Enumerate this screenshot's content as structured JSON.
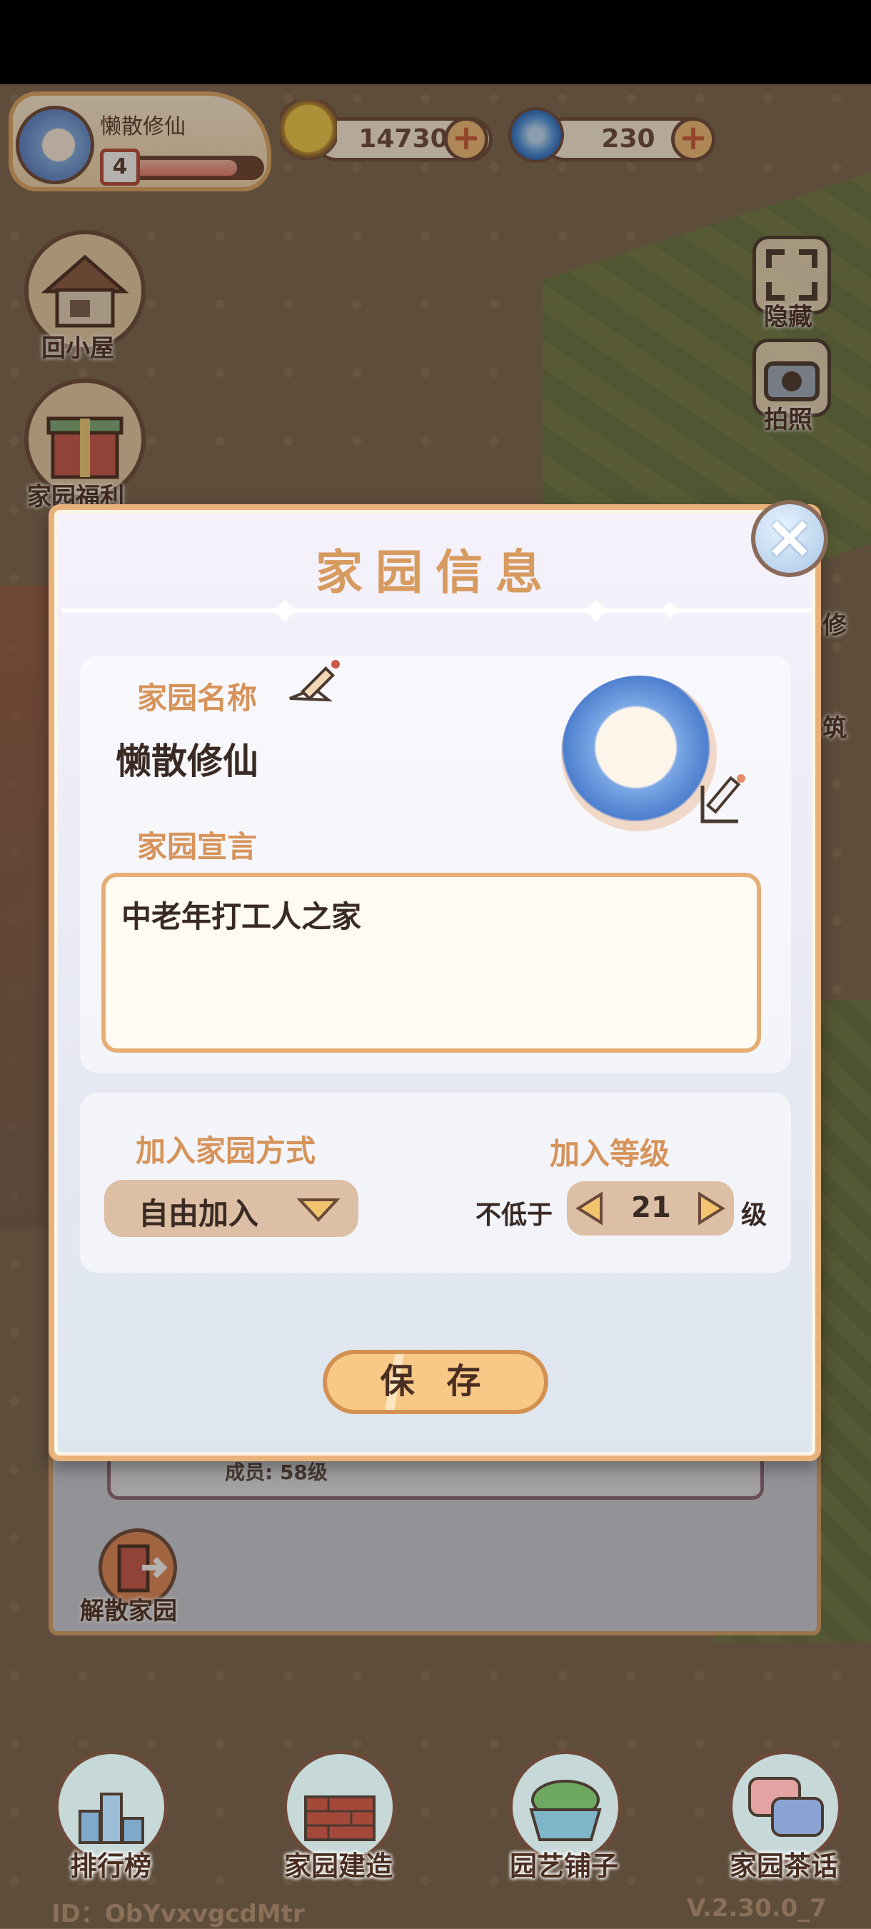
{
  "hud": {
    "player_name": "懒散修仙",
    "player_level": "4",
    "coins": "14730",
    "gems": "230",
    "level_progress": 0.8
  },
  "left_menu": {
    "home": "回小屋",
    "benefits": "家园福利"
  },
  "right_menu": {
    "hide": "隐藏",
    "photo": "拍照",
    "decorate": "修",
    "build": "筑"
  },
  "dialog": {
    "title": "家园信息",
    "name_label": "家园名称",
    "name_value": "懒散修仙",
    "declaration_label": "家园宣言",
    "declaration_value": "中老年打工人之家",
    "join_method_label": "加入家园方式",
    "join_method_value": "自由加入",
    "join_level_label": "加入等级",
    "min_prefix": "不低于",
    "min_level": "21",
    "level_suffix": "级",
    "save_label": "保 存"
  },
  "background_panel": {
    "member_text": "成员: 58级",
    "dissolve_label": "解散家园"
  },
  "bottom_nav": {
    "ranking": "排行榜",
    "build": "家园建造",
    "garden_shop": "园艺铺子",
    "tea_talk": "家园茶话"
  },
  "footer": {
    "id_text": "ID：ObYvxvgcdMtr",
    "version": "V.2.30.0_7"
  },
  "colors": {
    "accent_orange": "#d6935a",
    "frame": "#e9b27a",
    "text_dark": "#3a2a24"
  }
}
